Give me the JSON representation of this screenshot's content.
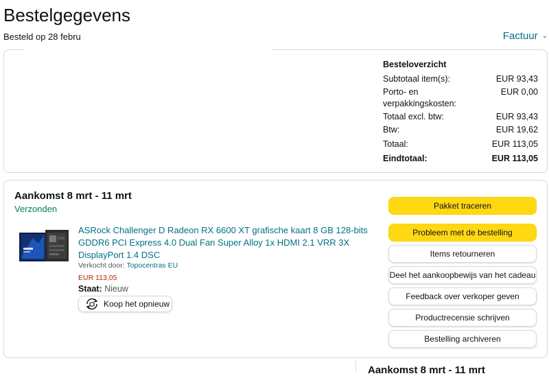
{
  "page": {
    "title": "Bestelgegevens",
    "order_date": "Besteld op 28 febru",
    "invoice_label": "Factuur"
  },
  "summary": {
    "heading": "Besteloverzicht",
    "rows": [
      {
        "label": "Subtotaal item(s):",
        "value": "EUR 93,43"
      },
      {
        "label": "Porto- en verpakkingskosten:",
        "value": "EUR 0,00"
      },
      {
        "label": "Totaal excl. btw:",
        "value": "EUR 93,43"
      },
      {
        "label": "Btw:",
        "value": "EUR 19,62"
      },
      {
        "label": "Totaal:",
        "value": "EUR 113,05"
      },
      {
        "label": "Eindtotaal:",
        "value": "EUR 113,05"
      }
    ]
  },
  "shipment": {
    "title": "Aankomst 8 mrt - 11 mrt",
    "status": "Verzonden",
    "product": {
      "title": "ASRock Challenger D Radeon RX 6600 XT grafische kaart 8 GB 128-bits GDDR6 PCI Express 4.0 Dual Fan Super Alloy 1x HDMI 2.1 VRR 3X DisplayPort 1.4 DSC",
      "sold_by_label": "Verkocht door:",
      "seller": "Topocentras EU",
      "price": "EUR 113,05",
      "condition_label": "Staat:",
      "condition": "Nieuw",
      "buy_again": "Koop het opnieuw",
      "image_icon": "graphics-card-box-image"
    },
    "actions": [
      "Pakket traceren",
      "Probleem met de bestelling",
      "Items retourneren",
      "Deel het aankoopbewijs van het cadeau",
      "Feedback over verkoper geven",
      "Productrecensie schrijven",
      "Bestelling archiveren"
    ]
  },
  "next_shipment": {
    "title": "Aankomst 8 mrt - 11 mrt"
  },
  "colors": {
    "accent": "#ffd814",
    "link": "#007185",
    "status": "#067d62",
    "price": "#b12704"
  }
}
